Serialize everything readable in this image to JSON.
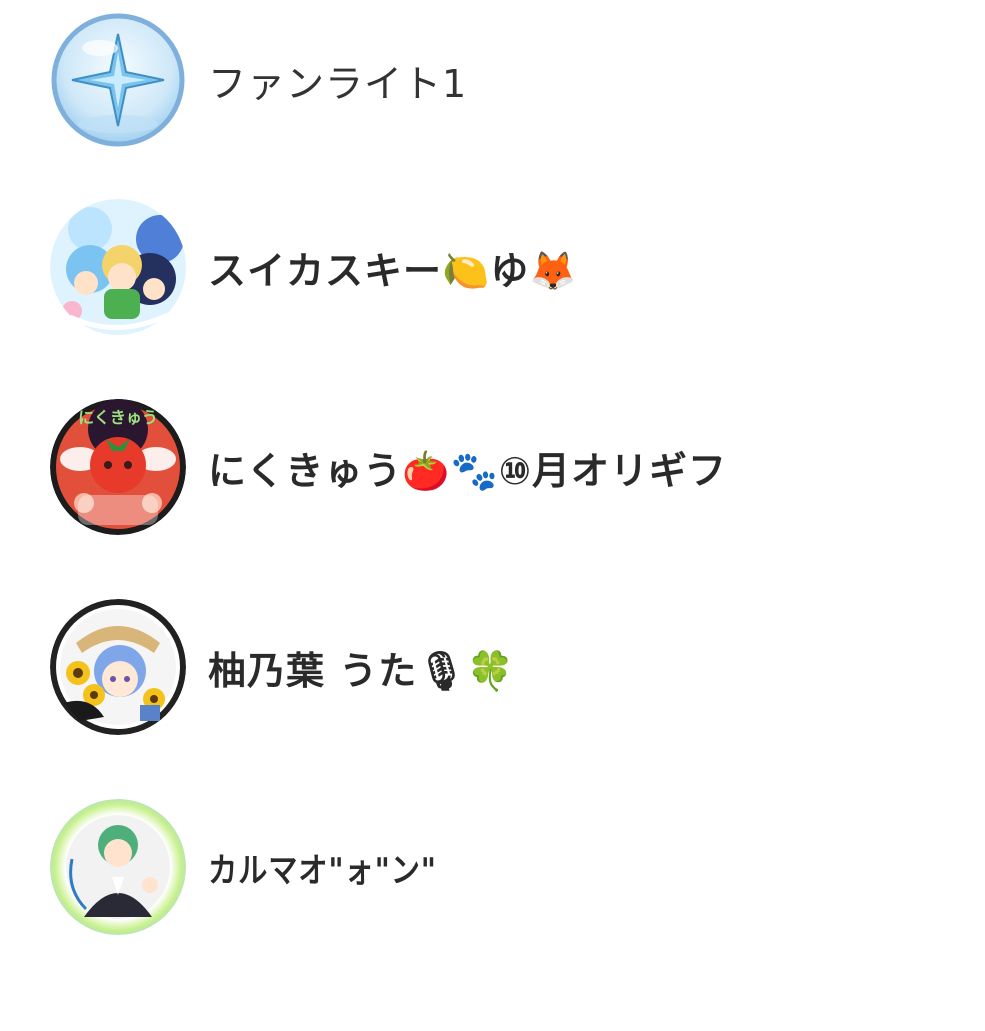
{
  "users": [
    {
      "name": "ファンライト1",
      "avatar_icon": "sparkle-bubble-icon"
    },
    {
      "name": "スイカスキー🍋ゆ🦊",
      "avatar_icon": "anime-characters-avatar"
    },
    {
      "name": "にくきゅう🍅🐾⑩月オリギフ",
      "avatar_icon": "tomato-mascot-avatar"
    },
    {
      "name": "柚乃葉 うた🎙🍀",
      "avatar_icon": "sunflower-girl-avatar"
    },
    {
      "name": "カルマオ\"ォ\"ン\"",
      "avatar_icon": "green-hair-boy-avatar"
    }
  ],
  "colors": {
    "text": "#2a2a2a",
    "bubble_blue": "#8fc7ee",
    "sparkle": "#5aaee0"
  }
}
